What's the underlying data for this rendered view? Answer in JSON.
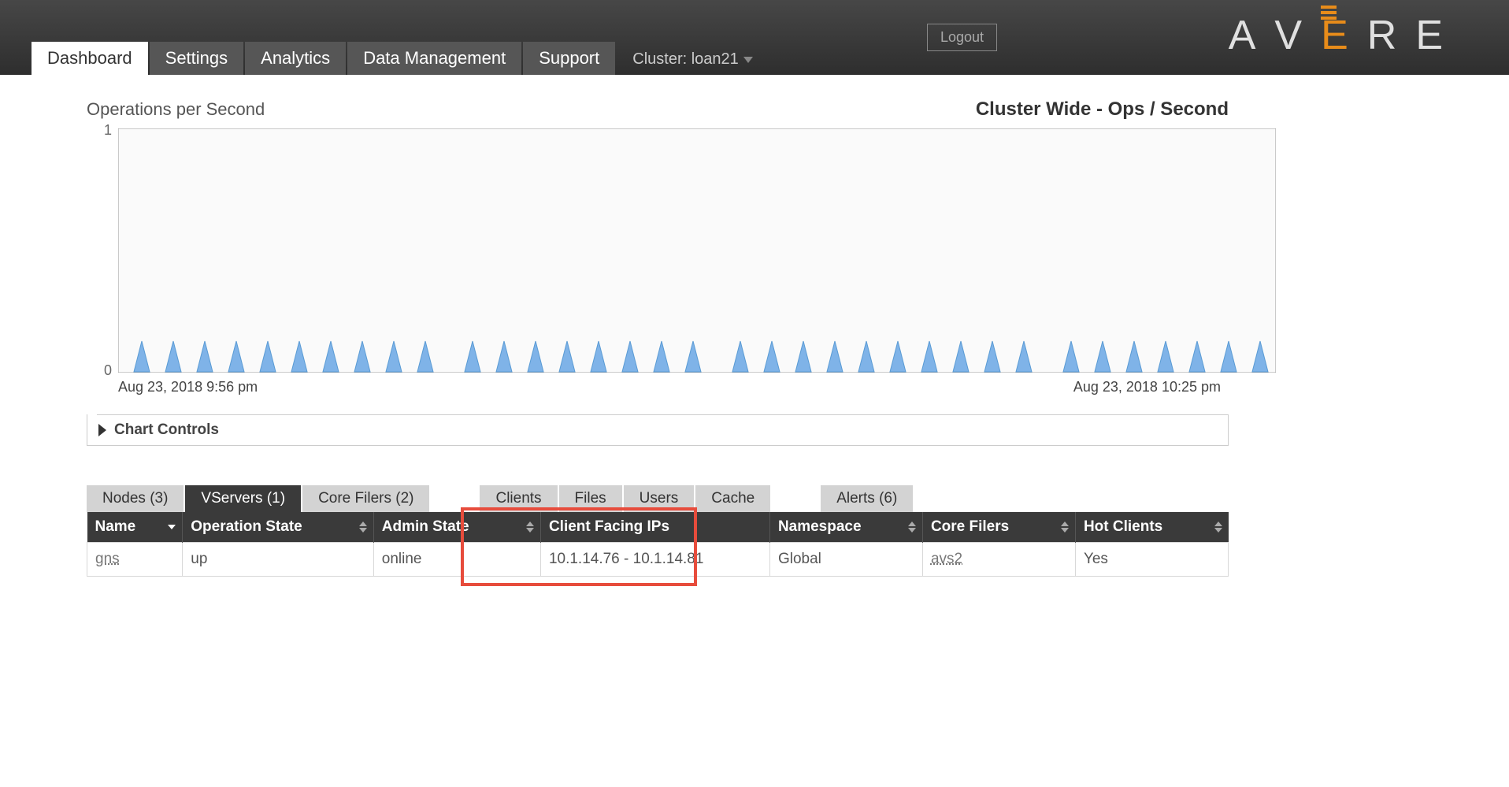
{
  "topbar": {
    "logout": "Logout",
    "brand_a1": "A",
    "brand_v": "V",
    "brand_e": "E",
    "brand_r": "R",
    "brand_e2": "E"
  },
  "nav": {
    "tabs": [
      {
        "label": "Dashboard",
        "active": true
      },
      {
        "label": "Settings",
        "active": false
      },
      {
        "label": "Analytics",
        "active": false
      },
      {
        "label": "Data Management",
        "active": false
      },
      {
        "label": "Support",
        "active": false
      }
    ],
    "cluster_label": "Cluster: loan21"
  },
  "chart": {
    "title_left": "Operations per Second",
    "title_right": "Cluster Wide - Ops / Second",
    "y_max": "1",
    "y_min": "0",
    "x_start": "Aug 23, 2018 9:56 pm",
    "x_end": "Aug 23, 2018 10:25 pm",
    "controls_label": "Chart Controls"
  },
  "chart_data": {
    "type": "line",
    "title": "Operations per Second",
    "xlabel": "",
    "ylabel": "",
    "ylim": [
      0,
      1
    ],
    "x_range": [
      "Aug 23, 2018 9:56 pm",
      "Aug 23, 2018 10:25 pm"
    ],
    "note": "Periodic short spikes from 0 up to ~0.3 roughly every minute, otherwise 0."
  },
  "sub_tabs": {
    "group1": [
      {
        "label": "Nodes (3)",
        "active": false
      },
      {
        "label": "VServers (1)",
        "active": true
      },
      {
        "label": "Core Filers (2)",
        "active": false
      }
    ],
    "group2": [
      {
        "label": "Clients",
        "active": false
      },
      {
        "label": "Files",
        "active": false
      },
      {
        "label": "Users",
        "active": false
      },
      {
        "label": "Cache",
        "active": false
      }
    ],
    "group3": [
      {
        "label": "Alerts (6)",
        "active": false
      }
    ]
  },
  "table": {
    "headers": [
      "Name",
      "Operation State",
      "Admin State",
      "Client Facing IPs",
      "Namespace",
      "Core Filers",
      "Hot Clients"
    ],
    "rows": [
      {
        "name": "gns",
        "op_state": "up",
        "admin_state": "online",
        "client_ips": "10.1.14.76 - 10.1.14.81",
        "namespace": "Global",
        "core_filers": "avs2",
        "hot_clients": "Yes"
      }
    ]
  }
}
